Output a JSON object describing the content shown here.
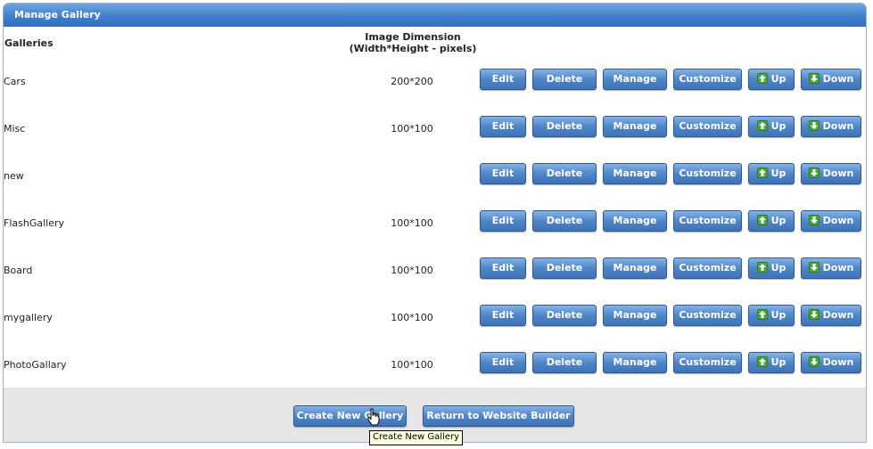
{
  "panel": {
    "title": "Manage Gallery"
  },
  "table": {
    "col_galleries": "Galleries",
    "col_dimension_line1": "Image Dimension",
    "col_dimension_line2": "(Width*Height - pixels)",
    "rows": [
      {
        "name": "Cars",
        "dimension": "200*200"
      },
      {
        "name": "Misc",
        "dimension": "100*100"
      },
      {
        "name": "new",
        "dimension": ""
      },
      {
        "name": "FlashGallery",
        "dimension": "100*100"
      },
      {
        "name": "Board",
        "dimension": "100*100"
      },
      {
        "name": "mygallery",
        "dimension": "100*100"
      },
      {
        "name": "PhotoGallary",
        "dimension": "100*100"
      }
    ]
  },
  "row_actions": {
    "edit": "Edit",
    "delete": "Delete",
    "manage": "Manage",
    "customize": "Customize",
    "up": "Up",
    "down": "Down"
  },
  "footer": {
    "create_label": "Create New Gallery",
    "return_label": "Return to Website Builder",
    "tooltip": "Create New Gallery"
  },
  "colors": {
    "header": "#3f7fcc",
    "button": "#4f86c8",
    "arrow_green": "#48a837",
    "footer_bg": "#e6e6e6"
  }
}
